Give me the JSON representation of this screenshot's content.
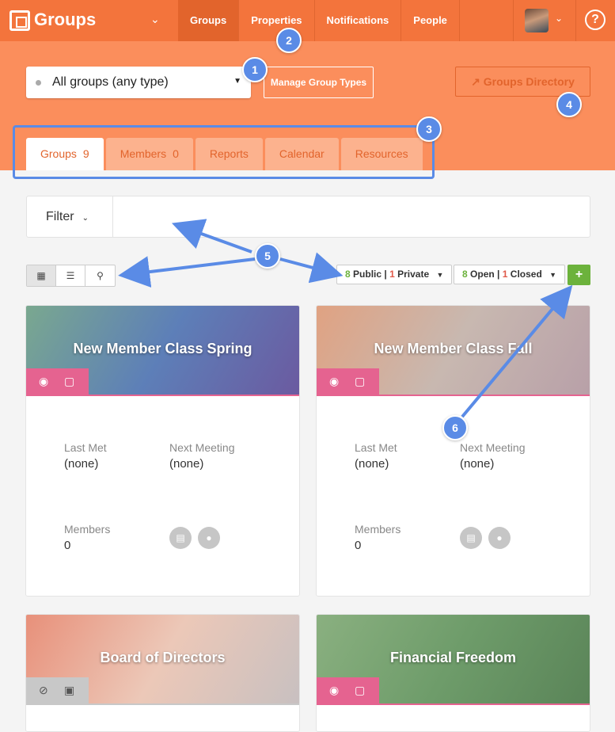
{
  "app": {
    "title": "Groups"
  },
  "nav": [
    "Groups",
    "Properties",
    "Notifications",
    "People"
  ],
  "header": {
    "group_type_select": "All groups (any type)",
    "manage_button": "Manage Group Types",
    "directory_button": "Groups Directory"
  },
  "tabs": [
    {
      "label": "Groups",
      "count": "9"
    },
    {
      "label": "Members",
      "count": "0"
    },
    {
      "label": "Reports",
      "count": ""
    },
    {
      "label": "Calendar",
      "count": ""
    },
    {
      "label": "Resources",
      "count": ""
    }
  ],
  "filter": {
    "label": "Filter",
    "value": ""
  },
  "visibility_filter": {
    "public_count": "8",
    "public_label": "Public",
    "sep": "|",
    "private_count": "1",
    "private_label": "Private"
  },
  "status_filter": {
    "open_count": "8",
    "open_label": "Open",
    "sep": "|",
    "closed_count": "1",
    "closed_label": "Closed"
  },
  "add_button": "+",
  "cards": [
    {
      "title": "New Member Class Spring",
      "last_met_label": "Last Met",
      "last_met": "(none)",
      "next_meeting_label": "Next Meeting",
      "next_meeting": "(none)",
      "members_label": "Members",
      "members": "0",
      "visibility_icon": "eye-icon",
      "badge_color": "#e56390",
      "banner_colors": [
        "#7aa88f",
        "#5d7fb8",
        "#6b5aa0"
      ]
    },
    {
      "title": "New Member Class Fall",
      "last_met_label": "Last Met",
      "last_met": "(none)",
      "next_meeting_label": "Next Meeting",
      "next_meeting": "(none)",
      "members_label": "Members",
      "members": "0",
      "visibility_icon": "eye-icon",
      "badge_color": "#e56390",
      "banner_colors": [
        "#e0a282",
        "#c8b8b0",
        "#b8a0a8"
      ]
    },
    {
      "title": "Board of Directors",
      "visibility_icon": "eye-slash-icon",
      "badge_color": "#c8c8c8",
      "banner_colors": [
        "#e8907a",
        "#ecc8b8",
        "#c8c0c0"
      ]
    },
    {
      "title": "Financial Freedom",
      "visibility_icon": "eye-icon",
      "badge_color": "#e56390",
      "banner_colors": [
        "#8ab080",
        "#6e9c6a",
        "#5a8458"
      ]
    }
  ],
  "callouts": [
    "1",
    "2",
    "3",
    "4",
    "5",
    "6"
  ],
  "colors": {
    "brand_orange": "#f3743c",
    "header_orange": "#fb8e5c",
    "callout_blue": "#5a8be6",
    "success_green": "#6cb23c",
    "badge_pink": "#e56390"
  }
}
